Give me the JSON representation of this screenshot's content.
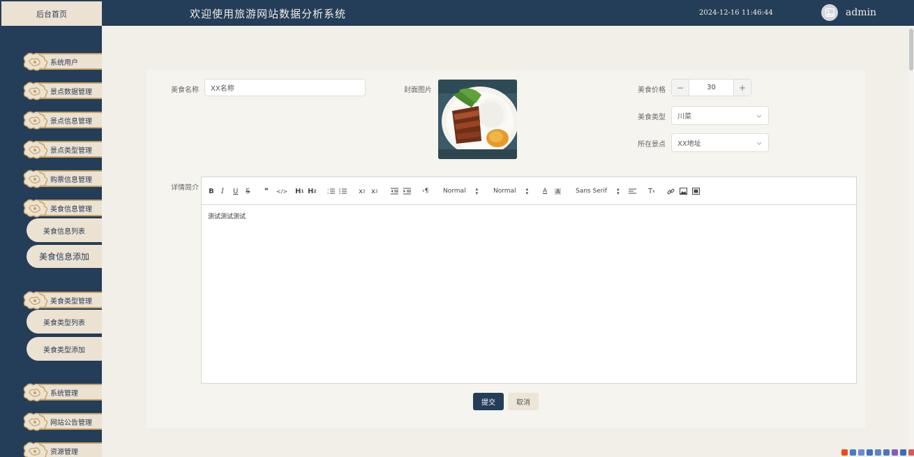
{
  "header": {
    "home_tab": "后台首页",
    "title": "欢迎使用旅游网站数据分析系统",
    "datetime": "2024-12-16 11:46:44",
    "username": "admin"
  },
  "sidebar": {
    "menus": [
      {
        "label": "系统用户"
      },
      {
        "label": "景点数据管理"
      },
      {
        "label": "景点信息管理"
      },
      {
        "label": "景点类型管理"
      },
      {
        "label": "购票信息管理"
      },
      {
        "label": "美食信息管理"
      },
      {
        "label": "美食类型管理"
      },
      {
        "label": "系统管理"
      },
      {
        "label": "网站公告管理"
      },
      {
        "label": "资源管理"
      }
    ],
    "food_subitems": [
      {
        "label": "美食信息列表"
      },
      {
        "label": "美食信息添加"
      }
    ],
    "foodtype_subitems": [
      {
        "label": "美食类型列表"
      },
      {
        "label": "美食类型添加"
      }
    ]
  },
  "form": {
    "name_label": "美食名称",
    "name_value": "XX名称",
    "cover_label": "封面图片",
    "price_label": "美食价格",
    "price_value": "30",
    "type_label": "美食类型",
    "type_value": "川菜",
    "spot_label": "所在景点",
    "spot_value": "XX地址",
    "detail_label": "详情简介",
    "detail_content": "测试测试测试",
    "submit_label": "提交",
    "cancel_label": "取消"
  },
  "editor_toolbar": {
    "header_select": "Normal",
    "size_select": "Normal",
    "font_select": "Sans Serif"
  },
  "colors": {
    "navy": "#243d59",
    "cream": "#ece2d2",
    "gold": "#c7a45e"
  }
}
